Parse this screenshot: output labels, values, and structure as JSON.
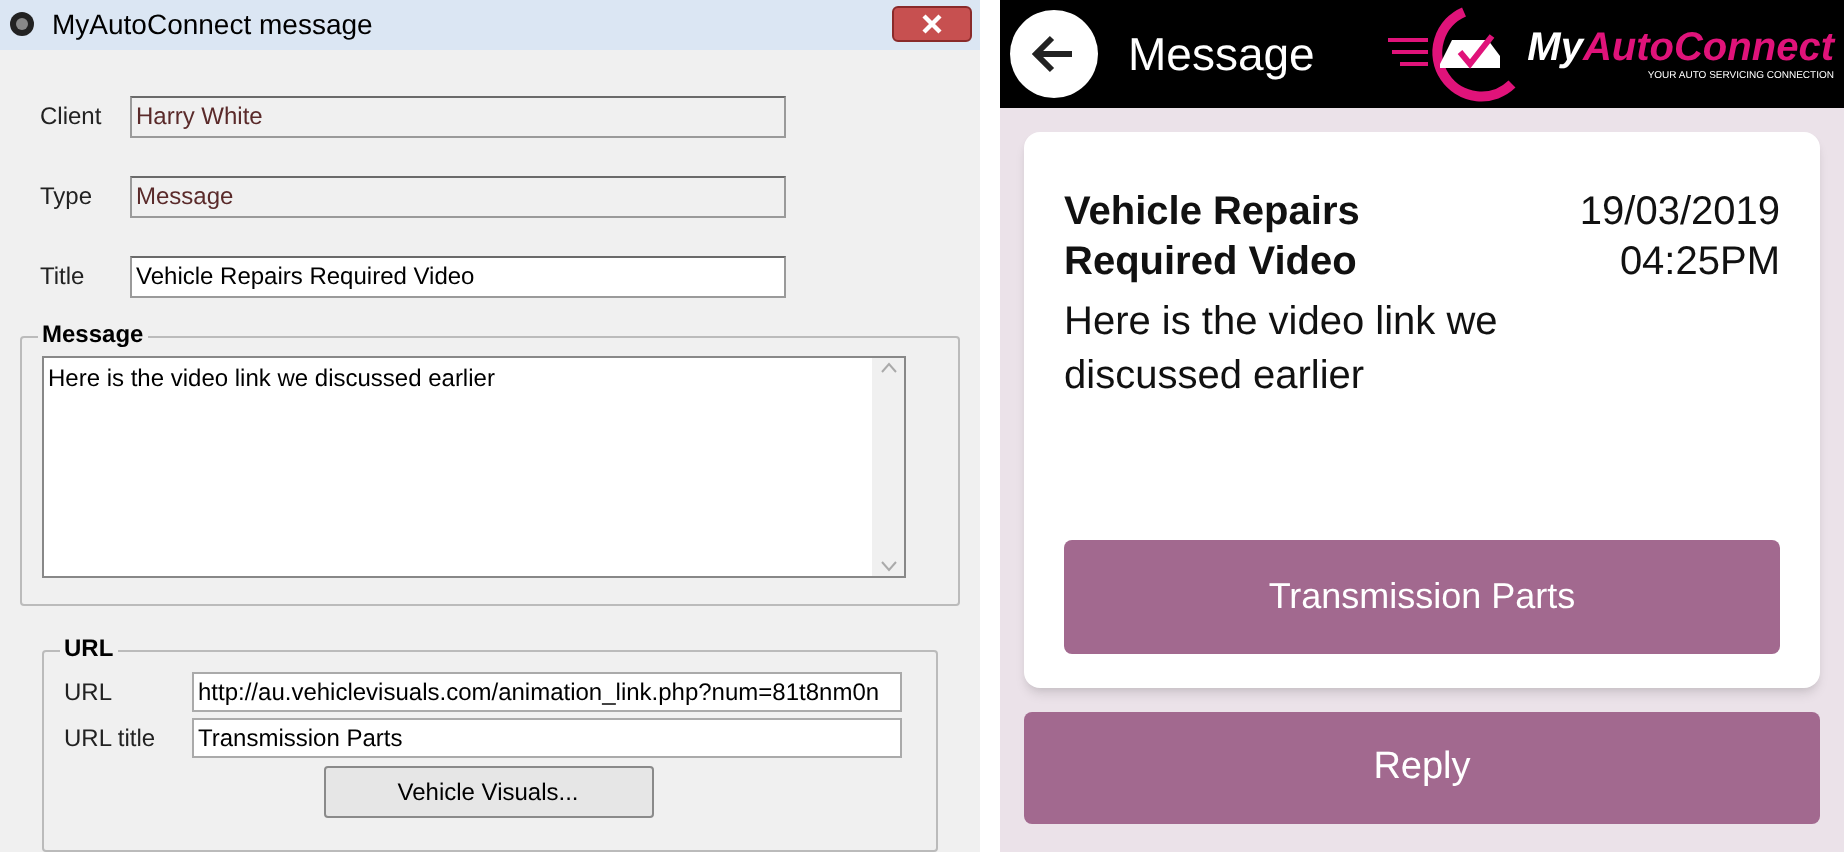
{
  "dialog": {
    "title": "MyAutoConnect message",
    "fields": [
      {
        "label": "Client",
        "value": "Harry White",
        "disabled": true
      },
      {
        "label": "Type",
        "value": "Message",
        "disabled": true
      },
      {
        "label": "Title",
        "value": "Vehicle Repairs Required Video",
        "disabled": false
      }
    ],
    "message_group": {
      "label": "Message",
      "value": "Here is the video link we discussed earlier"
    },
    "url_group": {
      "label": "URL",
      "fields": [
        {
          "label": "URL",
          "value": "http://au.vehiclevisuals.com/animation_link.php?num=81t8nm0n"
        },
        {
          "label": "URL title",
          "value": "Transmission Parts"
        }
      ],
      "button": "Vehicle Visuals..."
    }
  },
  "phone": {
    "header": {
      "title": "Message",
      "logo_part_1": "My",
      "logo_part_2": "AutoConnect",
      "tagline": "YOUR AUTO SERVICING CONNECTION"
    },
    "card": {
      "title": "Vehicle Repairs Required Video",
      "date": "19/03/2019",
      "time": "04:25PM",
      "body": "Here is the video link we discussed earlier",
      "link_button": "Transmission Parts"
    },
    "reply_button": "Reply"
  }
}
